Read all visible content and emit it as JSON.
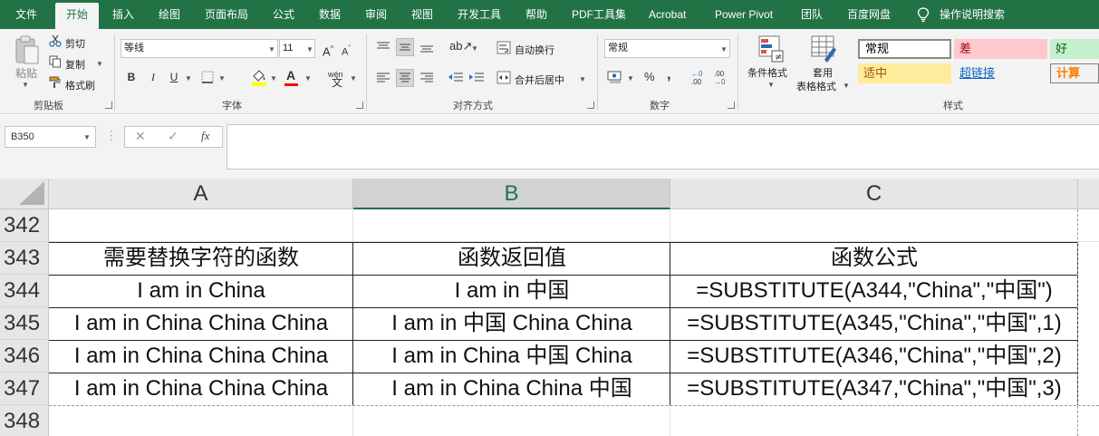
{
  "menu": {
    "tabs": [
      "文件",
      "开始",
      "插入",
      "绘图",
      "页面布局",
      "公式",
      "数据",
      "审阅",
      "视图",
      "开发工具",
      "帮助",
      "PDF工具集",
      "Acrobat",
      "Power Pivot",
      "团队",
      "百度网盘"
    ],
    "active_tab": "开始",
    "tell_me": "操作说明搜索"
  },
  "ribbon": {
    "clipboard": {
      "label": "剪贴板",
      "paste": "粘贴",
      "cut": "剪切",
      "copy": "复制",
      "format_painter": "格式刷"
    },
    "font": {
      "label": "字体",
      "font_name": "等线",
      "font_size": "11",
      "bold": "B",
      "italic": "I",
      "underline": "U",
      "wen": "wén"
    },
    "alignment": {
      "label": "对齐方式",
      "wrap_text": "自动换行",
      "merge_center": "合并后居中"
    },
    "number": {
      "label": "数字",
      "format": "常规",
      "percent": "%"
    },
    "styles": {
      "label": "样式",
      "conditional_format_line1": "条件格式",
      "table_format_line1": "套用",
      "table_format_line2": "表格格式",
      "cells": [
        {
          "name": "常规",
          "bg": "#ffffff",
          "fg": "#000000"
        },
        {
          "name": "差",
          "bg": "#ffc7ce",
          "fg": "#9c0006"
        },
        {
          "name": "好",
          "bg": "#c6efce",
          "fg": "#006100"
        },
        {
          "name": "适中",
          "bg": "#ffeb9c",
          "fg": "#9c5700"
        },
        {
          "name": "超链接",
          "bg": "#f3f3f3",
          "fg": "#0563c1"
        },
        {
          "name": "计算",
          "bg": "#f2f2f2",
          "fg": "#fa7d00"
        }
      ]
    }
  },
  "formula_bar": {
    "name_box": "B350",
    "fx": "fx",
    "cancel": "✕",
    "enter": "✓",
    "content": ""
  },
  "grid": {
    "columns": [
      "A",
      "B",
      "C"
    ],
    "selected_column": "B",
    "rows": [
      {
        "num": "342",
        "cells": [
          "",
          "",
          ""
        ]
      },
      {
        "num": "343",
        "cells": [
          "需要替换字符的函数",
          "函数返回值",
          "函数公式"
        ]
      },
      {
        "num": "344",
        "cells": [
          "I am in China",
          "I am in 中国",
          "=SUBSTITUTE(A344,\"China\",\"中国\")"
        ]
      },
      {
        "num": "345",
        "cells": [
          "I am in China China China",
          "I am in 中国 China China",
          "=SUBSTITUTE(A345,\"China\",\"中国\",1)"
        ]
      },
      {
        "num": "346",
        "cells": [
          "I am in China China China",
          "I am in China 中国 China",
          "=SUBSTITUTE(A346,\"China\",\"中国\",2)"
        ]
      },
      {
        "num": "347",
        "cells": [
          "I am in China China China",
          "I am in China China 中国",
          "=SUBSTITUTE(A347,\"China\",\"中国\",3)"
        ]
      },
      {
        "num": "348",
        "cells": [
          "",
          "",
          ""
        ]
      }
    ]
  },
  "colors": {
    "accent": "#217346",
    "ribbon_bg": "#f3f3f3",
    "header_bg": "#e6e6e6",
    "header_selected_bg": "#d2d2d2"
  }
}
